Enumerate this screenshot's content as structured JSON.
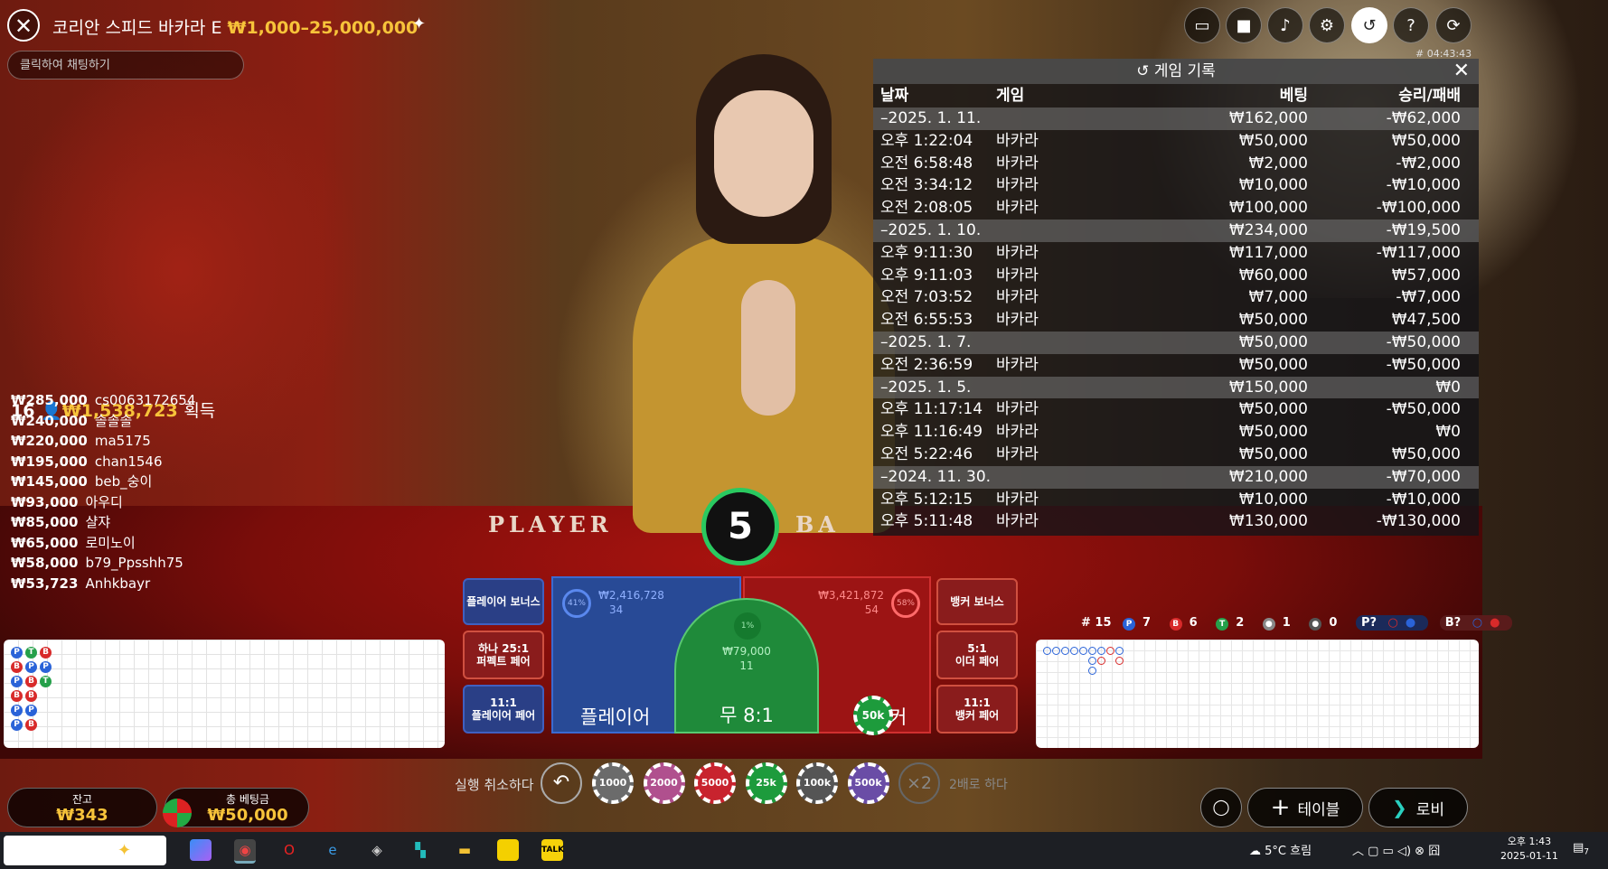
{
  "header": {
    "title": "코리안 스피드 바카라 E",
    "limits": "₩1,000–25,000,000",
    "chat_placeholder": "클릭하여 채팅하기",
    "game_id": "# 04:43:43"
  },
  "controls": [
    "chat-icon",
    "video-icon",
    "volume-icon",
    "settings-icon",
    "history-icon",
    "help-icon",
    "lobby-return-icon"
  ],
  "history": {
    "title": "게임 기록",
    "columns": {
      "date": "날짜",
      "game": "게임",
      "bet": "베팅",
      "result": "승리/패배"
    },
    "rows": [
      {
        "type": "date",
        "date": "–2025. 1. 11.",
        "game": "",
        "bet": "₩162,000",
        "result": "-₩62,000"
      },
      {
        "type": "item",
        "date": "오후 1:22:04",
        "game": "바카라",
        "bet": "₩50,000",
        "result": "₩50,000"
      },
      {
        "type": "item",
        "date": "오전 6:58:48",
        "game": "바카라",
        "bet": "₩2,000",
        "result": "-₩2,000"
      },
      {
        "type": "item",
        "date": "오전 3:34:12",
        "game": "바카라",
        "bet": "₩10,000",
        "result": "-₩10,000"
      },
      {
        "type": "item",
        "date": "오전 2:08:05",
        "game": "바카라",
        "bet": "₩100,000",
        "result": "-₩100,000"
      },
      {
        "type": "date",
        "date": "–2025. 1. 10.",
        "game": "",
        "bet": "₩234,000",
        "result": "-₩19,500"
      },
      {
        "type": "item",
        "date": "오후 9:11:30",
        "game": "바카라",
        "bet": "₩117,000",
        "result": "-₩117,000"
      },
      {
        "type": "item",
        "date": "오후 9:11:03",
        "game": "바카라",
        "bet": "₩60,000",
        "result": "₩57,000"
      },
      {
        "type": "item",
        "date": "오전 7:03:52",
        "game": "바카라",
        "bet": "₩7,000",
        "result": "-₩7,000"
      },
      {
        "type": "item",
        "date": "오전 6:55:53",
        "game": "바카라",
        "bet": "₩50,000",
        "result": "₩47,500"
      },
      {
        "type": "date",
        "date": "–2025. 1. 7.",
        "game": "",
        "bet": "₩50,000",
        "result": "-₩50,000"
      },
      {
        "type": "item",
        "date": "오전 2:36:59",
        "game": "바카라",
        "bet": "₩50,000",
        "result": "-₩50,000"
      },
      {
        "type": "date",
        "date": "–2025. 1. 5.",
        "game": "",
        "bet": "₩150,000",
        "result": "₩0"
      },
      {
        "type": "item",
        "date": "오후 11:17:14",
        "game": "바카라",
        "bet": "₩50,000",
        "result": "-₩50,000"
      },
      {
        "type": "item",
        "date": "오후 11:16:49",
        "game": "바카라",
        "bet": "₩50,000",
        "result": "₩0"
      },
      {
        "type": "item",
        "date": "오전 5:22:46",
        "game": "바카라",
        "bet": "₩50,000",
        "result": "₩50,000"
      },
      {
        "type": "date",
        "date": "–2024. 11. 30.",
        "game": "",
        "bet": "₩210,000",
        "result": "-₩70,000"
      },
      {
        "type": "item",
        "date": "오후 5:12:15",
        "game": "바카라",
        "bet": "₩10,000",
        "result": "-₩10,000"
      },
      {
        "type": "item",
        "date": "오후 5:11:48",
        "game": "바카라",
        "bet": "₩130,000",
        "result": "-₩130,000"
      }
    ]
  },
  "winners": {
    "count": "16",
    "total": "₩1,538,723",
    "suffix": "획득",
    "list": [
      {
        "amount": "₩285,000",
        "name": "cs0063172654"
      },
      {
        "amount": "₩240,000",
        "name": "솔솔솔"
      },
      {
        "amount": "₩220,000",
        "name": "ma5175"
      },
      {
        "amount": "₩195,000",
        "name": "chan1546"
      },
      {
        "amount": "₩145,000",
        "name": "beb_숭이"
      },
      {
        "amount": "₩93,000",
        "name": "아우디"
      },
      {
        "amount": "₩85,000",
        "name": "샬쟈"
      },
      {
        "amount": "₩65,000",
        "name": "로미노이"
      },
      {
        "amount": "₩58,000",
        "name": "b79_Ppsshh75"
      },
      {
        "amount": "₩53,723",
        "name": "Anhkbayr"
      }
    ]
  },
  "table": {
    "timer": "5",
    "felt_player": "PLAYER",
    "felt_banker": "BA",
    "player_bonus": "플레이어 보너스",
    "banker_bonus": "뱅커 보너스",
    "perfect_pair_odds": "하나 25:1",
    "perfect_pair": "퍼펙트 페어",
    "player_pair_odds": "11:1",
    "player_pair": "플레이어 페어",
    "either_pair_odds": "5:1",
    "either_pair": "이더 페어",
    "banker_pair_odds": "11:1",
    "banker_pair": "뱅커 페어",
    "player_label": "플레이어",
    "player_pct": "41%",
    "player_total": "₩2,416,728",
    "player_players": "34",
    "tie_label": "무 8:1",
    "tie_pct": "1%",
    "tie_total": "₩79,000",
    "tie_players": "11",
    "banker_label": "커",
    "banker_pct": "58%",
    "banker_total": "₩3,421,872",
    "banker_players": "54",
    "placed_chip": "50k"
  },
  "roads": {
    "bead": [
      [
        "P",
        "T",
        "B"
      ],
      [
        "B",
        "P",
        "P"
      ],
      [
        "P",
        "B",
        "T"
      ],
      [
        "B",
        "B"
      ],
      [
        "P",
        "P"
      ],
      [
        "P",
        "B"
      ]
    ],
    "stats": {
      "rounds": "# 15",
      "player": "7",
      "banker": "6",
      "tie": "2",
      "player_pair": "1",
      "banker_pair": "0",
      "player_ask": "P?",
      "banker_ask": "B?"
    }
  },
  "betting": {
    "undo_label": "실행 취소하다",
    "chips": [
      "1000",
      "2000",
      "5000",
      "25k",
      "100k",
      "500k"
    ],
    "double": "×2",
    "double_label": "2배로 하다",
    "balance_label": "잔고",
    "balance": "₩343",
    "total_bet_label": "총 베팅금",
    "total_bet": "₩50,000",
    "table_btn": "테이블",
    "lobby_btn": "로비"
  },
  "colors": {
    "gold": "#f7c33a",
    "player": "#2a63d8",
    "banker": "#d82a2a",
    "tie": "#25a04a"
  },
  "taskbar": {
    "weather": "5°C  흐림",
    "time": "오후 1:43",
    "date": "2025-01-11",
    "notifications": "7"
  }
}
